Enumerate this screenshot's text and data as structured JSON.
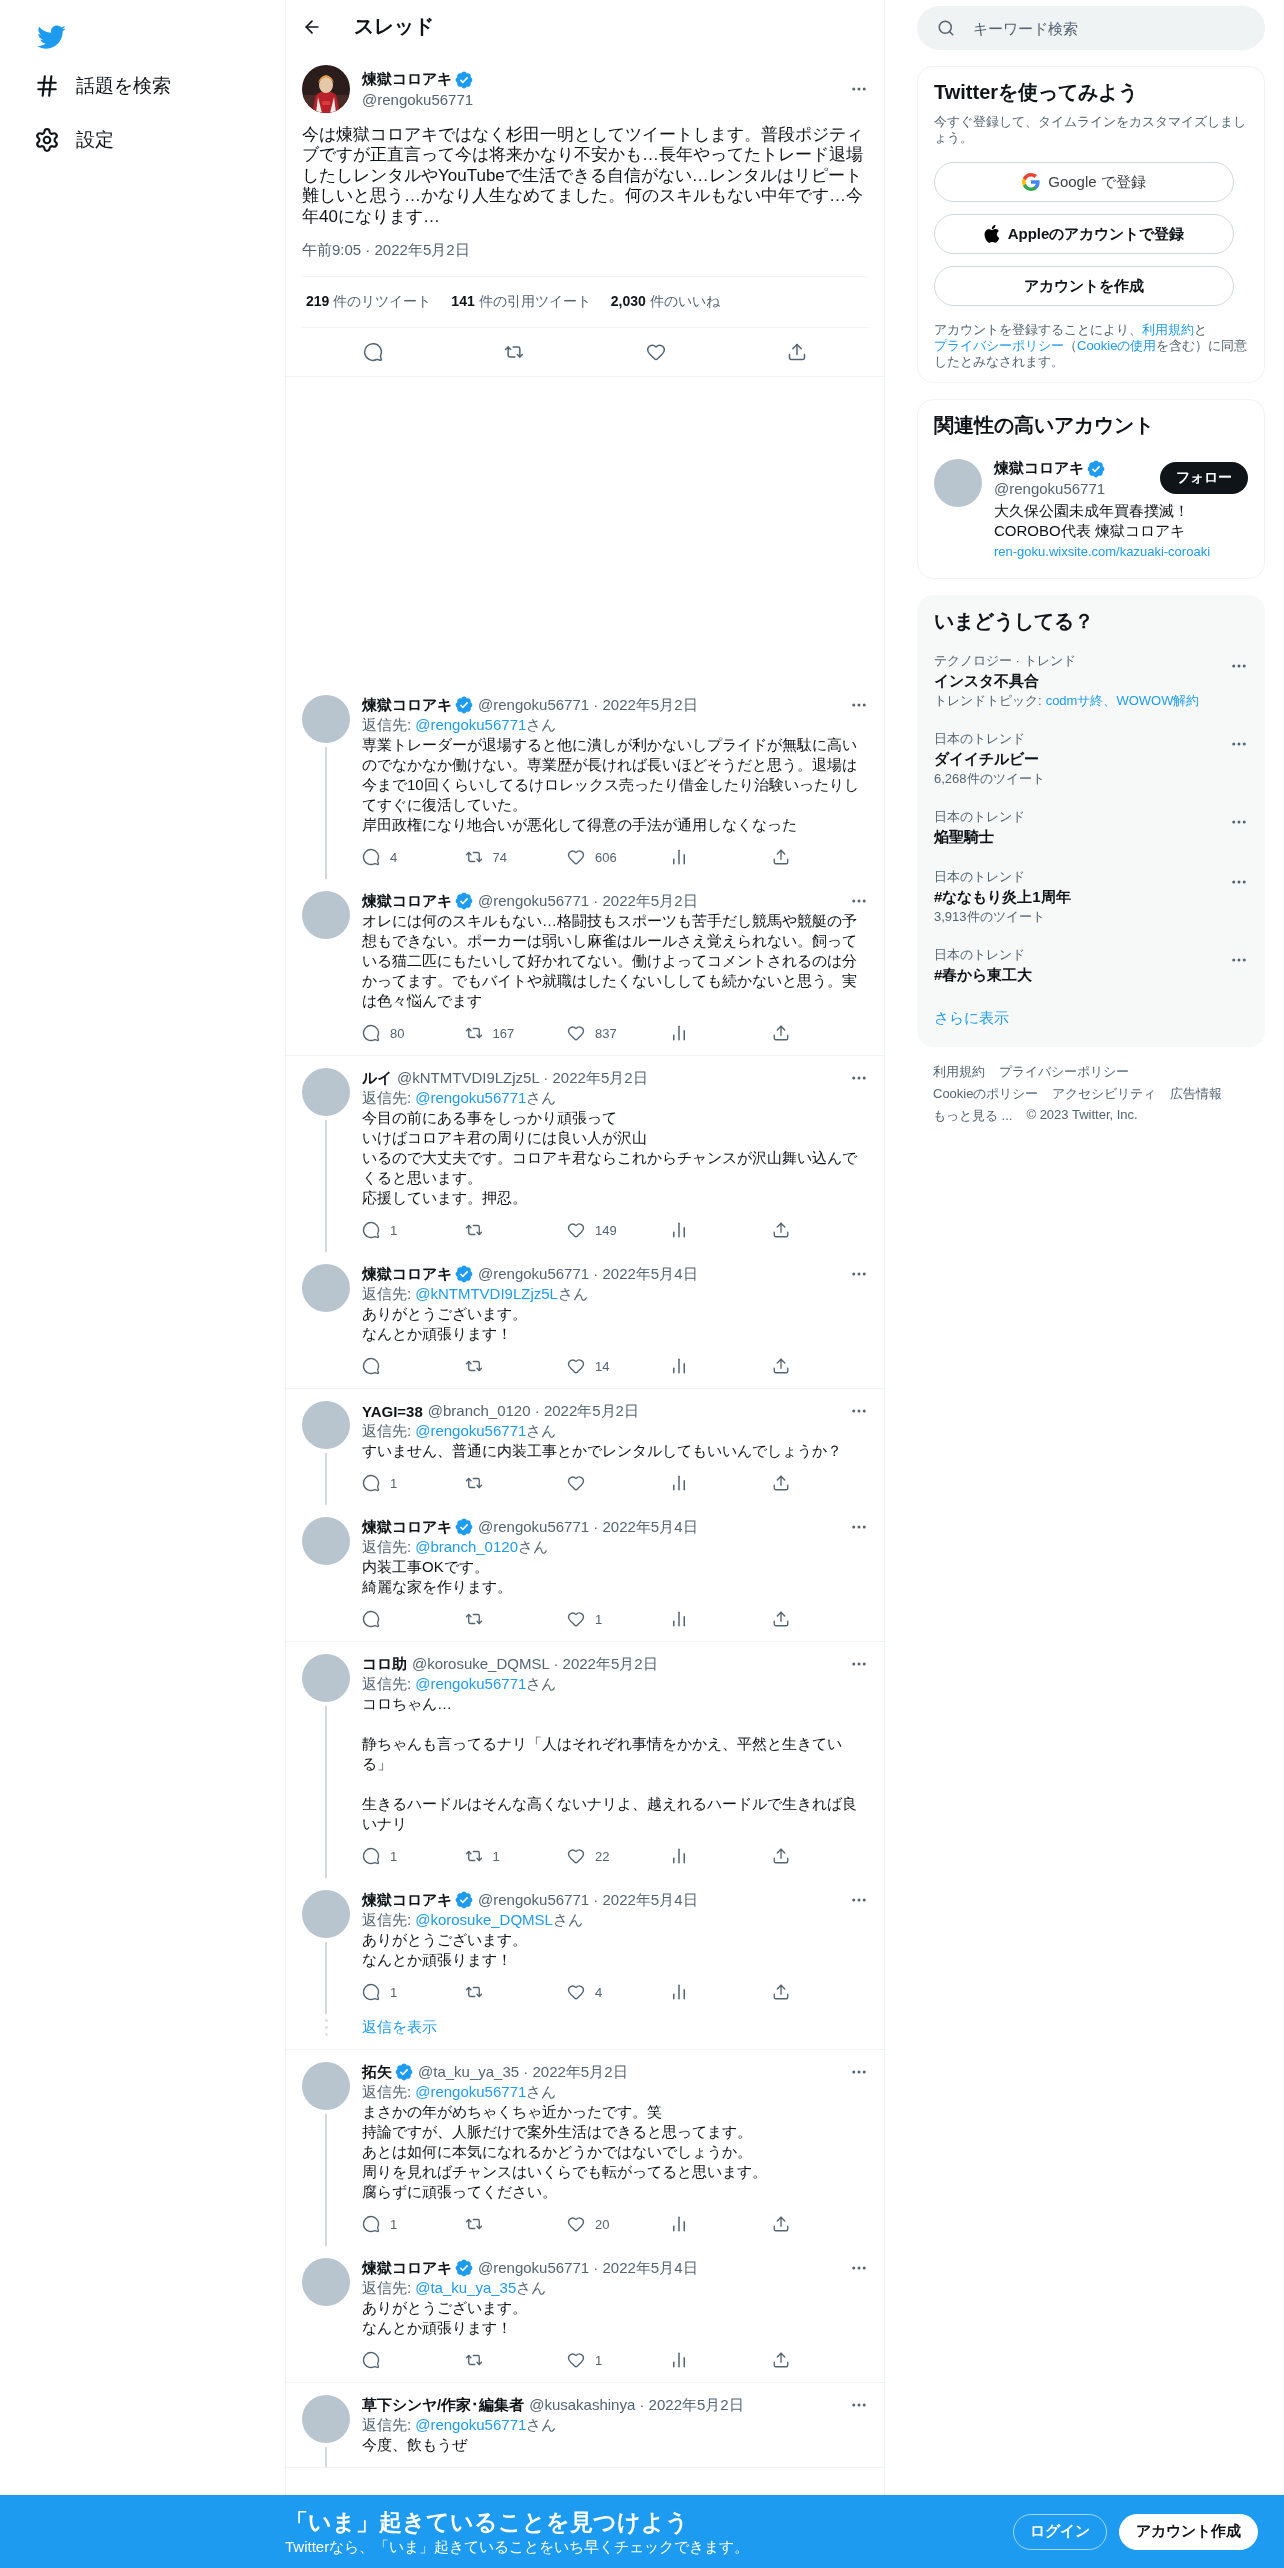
{
  "nav": {
    "items": [
      {
        "label": "話題を検索"
      },
      {
        "label": "設定"
      }
    ]
  },
  "header": {
    "title": "スレッド"
  },
  "main_tweet": {
    "name": "煉獄コロアキ",
    "verified": true,
    "handle": "@rengoku56771",
    "text": "今は煉獄コロアキではなく杉田一明としてツイートします。普段ポジティブですが正直言って今は将来かなり不安かも…長年やってたトレード退場したしレンタルやYouTubeで生活できる自信がない…レンタルはリピート難しいと思う…かなり人生なめてました。何のスキルもない中年です…今年40になります…",
    "date": "午前9:05 · 2022年5月2日",
    "stats": [
      {
        "count": "219",
        "label": "件のリツイート"
      },
      {
        "count": "141",
        "label": "件の引用ツイート"
      },
      {
        "count": "2,030",
        "label": "件のいいね"
      }
    ]
  },
  "replies": [
    {
      "continues": false,
      "tweets": [
        {
          "name": "煉獄コロアキ",
          "verified": true,
          "meta": "@rengoku56771 · 2022年5月2日",
          "reply_to": {
            "label": "返信先:",
            "handle": "@rengoku56771",
            "suffix": "さん"
          },
          "paragraphs": [
            [
              "専業トレーダーが退場すると他に潰しが利かないしプライドが無駄に高いのでなかなか働けない。専業歴が長ければ長いほどそうだと思う。退場は今まで10回くらいしてるけロレックス売ったり借金したり治験いったりしてすぐに復活していた。",
              "岸田政権になり地合いが悪化して得意の手法が通用しなくなった"
            ]
          ],
          "actions": true,
          "replies": "4",
          "retweets": "74",
          "likes": "606"
        },
        {
          "name": "煉獄コロアキ",
          "verified": true,
          "meta": "@rengoku56771 · 2022年5月2日",
          "paragraphs": [
            [
              "オレには何のスキルもない…格闘技もスポーツも苦手だし競馬や競艇の予想もできない。ポーカーは弱いし麻雀はルールさえ覚えられない。飼っている猫二匹にもたいして好かれてない。働けよってコメントされるのは分かってます。でもバイトや就職はしたくないししても続かないと思う。実は色々悩んでます"
            ]
          ],
          "actions": true,
          "replies": "80",
          "retweets": "167",
          "likes": "837"
        }
      ]
    },
    {
      "continues": false,
      "tweets": [
        {
          "name": "ルイ",
          "verified": false,
          "meta": "@kNTMTVDI9LZjz5L · 2022年5月2日",
          "reply_to": {
            "label": "返信先:",
            "handle": "@rengoku56771",
            "suffix": "さん"
          },
          "paragraphs": [
            [
              "今目の前にある事をしっかり頑張って",
              "いけばコロアキ君の周りには良い人が沢山",
              "いるので大丈夫です。コロアキ君ならこれからチャンスが沢山舞い込んでくると思います。",
              "応援しています。押忍。"
            ]
          ],
          "actions": true,
          "replies": "1",
          "likes": "149"
        },
        {
          "name": "煉獄コロアキ",
          "verified": true,
          "meta": "@rengoku56771 · 2022年5月4日",
          "reply_to": {
            "label": "返信先:",
            "handle": "@kNTMTVDI9LZjz5L",
            "suffix": "さん"
          },
          "paragraphs": [
            [
              "ありがとうございます。",
              "なんとか頑張ります！"
            ]
          ],
          "actions": true,
          "likes": "14"
        }
      ]
    },
    {
      "continues": false,
      "tweets": [
        {
          "name": "YAGI=38",
          "verified": false,
          "meta": "@branch_0120 · 2022年5月2日",
          "reply_to": {
            "label": "返信先:",
            "handle": "@rengoku56771",
            "suffix": "さん"
          },
          "paragraphs": [
            [
              "すいません、普通に内装工事とかでレンタルしてもいいんでしょうか？"
            ]
          ],
          "actions": true,
          "replies": "1"
        },
        {
          "name": "煉獄コロアキ",
          "verified": true,
          "meta": "@rengoku56771 · 2022年5月4日",
          "reply_to": {
            "label": "返信先:",
            "handle": "@branch_0120",
            "suffix": "さん"
          },
          "paragraphs": [
            [
              "内装工事OKです。",
              "綺麗な家を作ります。"
            ]
          ],
          "actions": true,
          "likes": "1"
        }
      ]
    },
    {
      "continues": false,
      "show_more": "返信を表示",
      "tweets": [
        {
          "name": "コロ助",
          "verified": false,
          "meta": "@korosuke_DQMSL · 2022年5月2日",
          "reply_to": {
            "label": "返信先:",
            "handle": "@rengoku56771",
            "suffix": "さん"
          },
          "paragraphs": [
            [
              "コロちゃん…"
            ],
            [
              "静ちゃんも言ってるナリ「人はそれぞれ事情をかかえ、平然と生きている」"
            ],
            [
              "生きるハードルはそんな高くないナリよ、越えれるハードルで生きれば良いナリ"
            ]
          ],
          "actions": true,
          "replies": "1",
          "retweets": "1",
          "likes": "22"
        },
        {
          "name": "煉獄コロアキ",
          "verified": true,
          "meta": "@rengoku56771 · 2022年5月4日",
          "reply_to": {
            "label": "返信先:",
            "handle": "@korosuke_DQMSL",
            "suffix": "さん"
          },
          "paragraphs": [
            [
              "ありがとうございます。",
              "なんとか頑張ります！"
            ]
          ],
          "actions": true,
          "replies": "1",
          "likes": "4"
        }
      ]
    },
    {
      "continues": false,
      "tweets": [
        {
          "name": "拓矢",
          "verified": true,
          "meta": "@ta_ku_ya_35 · 2022年5月2日",
          "reply_to": {
            "label": "返信先:",
            "handle": "@rengoku56771",
            "suffix": "さん"
          },
          "paragraphs": [
            [
              "まさかの年がめちゃくちゃ近かったです。笑",
              "持論ですが、人脈だけで案外生活はできると思ってます。",
              "あとは如何に本気になれるかどうかではないでしょうか。",
              "周りを見ればチャンスはいくらでも転がってると思います。",
              "腐らずに頑張ってください。"
            ]
          ],
          "actions": true,
          "replies": "1",
          "likes": "20"
        },
        {
          "name": "煉獄コロアキ",
          "verified": true,
          "meta": "@rengoku56771 · 2022年5月4日",
          "reply_to": {
            "label": "返信先:",
            "handle": "@ta_ku_ya_35",
            "suffix": "さん"
          },
          "paragraphs": [
            [
              "ありがとうございます。",
              "なんとか頑張ります！"
            ]
          ],
          "actions": true,
          "likes": "1"
        }
      ]
    },
    {
      "continues": true,
      "tweets": [
        {
          "name": "草下シンヤ/作家･編集者",
          "verified": false,
          "meta": "@kusakashinya · 2022年5月2日",
          "reply_to": {
            "label": "返信先:",
            "handle": "@rengoku56771",
            "suffix": "さん"
          },
          "paragraphs": [
            [
              "今度、飲もうぜ"
            ]
          ],
          "actions": false
        }
      ]
    }
  ],
  "search": {
    "placeholder": "キーワード検索"
  },
  "signup": {
    "title": "Twitterを使ってみよう",
    "subtitle": "今すぐ登録して、タイムラインをカスタマイズしましょう。",
    "buttons": [
      {
        "kind": "google",
        "label": "Google で登録"
      },
      {
        "kind": "apple",
        "label": "Appleのアカウントで登録"
      },
      {
        "kind": "plain",
        "label": "アカウントを作成"
      }
    ],
    "legal": [
      {
        "text": "アカウントを登録することにより、",
        "link": false
      },
      {
        "text": "利用規約",
        "link": true
      },
      {
        "text": "と",
        "link": false
      },
      {
        "text": "プライバシーポリシー",
        "link": true
      },
      {
        "text": "（",
        "link": false
      },
      {
        "text": "Cookieの使用",
        "link": true
      },
      {
        "text": "を含む）に同意したとみなされます。",
        "link": false
      }
    ]
  },
  "who_to_follow": {
    "title": "関連性の高いアカウント",
    "account": {
      "name": "煉獄コロアキ",
      "verified": true,
      "handle": "@rengoku56771",
      "button": "フォロー",
      "bio": [
        {
          "text": "大久保公園未成年買春撲滅！\nCOROBO代表 煉獄コロアキ",
          "link": false
        },
        {
          "text": "ren-goku.wixsite.com/kazuaki-coroaki",
          "link": true
        }
      ]
    }
  },
  "trends": {
    "title": "いまどうしてる？",
    "show_more": "さらに表示",
    "items": [
      {
        "category": "テクノロジー · トレンド",
        "title": "インスタ不具合",
        "topics_label": "トレンドトピック:",
        "topics": "codmサ終、WOWOW解約"
      },
      {
        "category": "日本のトレンド",
        "title": "ダイイチルビー",
        "count": "6,268件のツイート"
      },
      {
        "category": "日本のトレンド",
        "title": "焔聖騎士"
      },
      {
        "category": "日本のトレンド",
        "title": "#ななもり炎上1周年",
        "count": "3,913件のツイート"
      },
      {
        "category": "日本のトレンド",
        "title": "#春から東工大"
      }
    ]
  },
  "footer": [
    [
      "利用規約",
      "プライバシーポリシー"
    ],
    [
      "Cookieのポリシー",
      "アクセシビリティ",
      "広告情報"
    ],
    [
      "もっと見る ..."
    ]
  ],
  "copyright": "© 2023 Twitter, Inc.",
  "banner": {
    "title": "「いま」起きていることを見つけよう",
    "subtitle": "Twitterなら、「いま」起きていることをいち早くチェックできます。",
    "buttons": [
      {
        "kind": "outline",
        "label": "ログイン"
      },
      {
        "kind": "filled",
        "label": "アカウント作成"
      }
    ]
  }
}
